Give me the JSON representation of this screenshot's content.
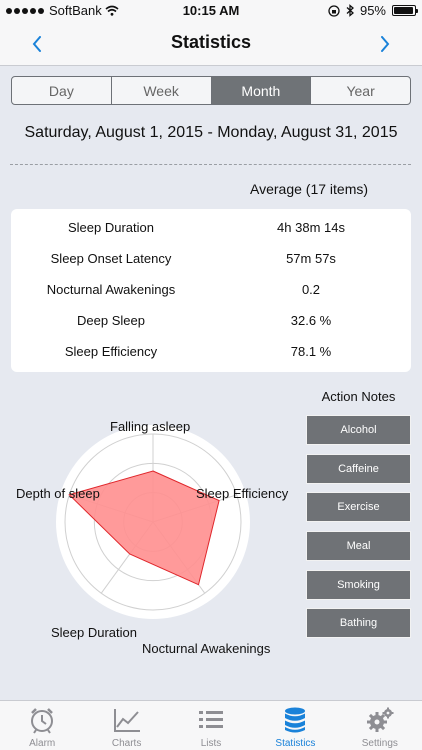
{
  "status_bar": {
    "carrier": "SoftBank",
    "time": "10:15 AM",
    "battery": "95%",
    "battery_level": 0.95
  },
  "nav": {
    "title": "Statistics"
  },
  "segments": [
    {
      "label": "Day",
      "active": false
    },
    {
      "label": "Week",
      "active": false
    },
    {
      "label": "Month",
      "active": true
    },
    {
      "label": "Year",
      "active": false
    }
  ],
  "date_range": "Saturday, August 1, 2015 - Monday, August 31, 2015",
  "average": {
    "title": "Average (17 items)",
    "rows": [
      {
        "label": "Sleep Duration",
        "value": "4h 38m 14s"
      },
      {
        "label": "Sleep Onset Latency",
        "value": "57m 57s"
      },
      {
        "label": "Nocturnal Awakenings",
        "value": "0.2"
      },
      {
        "label": "Deep Sleep",
        "value": "32.6 %"
      },
      {
        "label": "Sleep Efficiency",
        "value": "78.1 %"
      }
    ]
  },
  "radar": {
    "axes": [
      "Falling asleep",
      "Sleep Efficiency",
      "Nocturnal Awakenings",
      "Sleep Duration",
      "Depth of sleep"
    ],
    "values": [
      0.58,
      0.79,
      0.88,
      0.45,
      1.0
    ],
    "rings": 3,
    "fill_color": "#ff8f8f",
    "stroke_color": "#e0262b"
  },
  "action_notes": {
    "title": "Action Notes",
    "buttons": [
      "Alcohol",
      "Caffeine",
      "Exercise",
      "Meal",
      "Smoking",
      "Bathing"
    ]
  },
  "tabbar": [
    {
      "label": "Alarm",
      "icon": "alarm-clock-icon",
      "active": false
    },
    {
      "label": "Charts",
      "icon": "line-chart-icon",
      "active": false
    },
    {
      "label": "Lists",
      "icon": "list-icon",
      "active": false
    },
    {
      "label": "Statistics",
      "icon": "database-icon",
      "active": true
    },
    {
      "label": "Settings",
      "icon": "gear-icon",
      "active": false
    }
  ],
  "colors": {
    "accent": "#1a82d9",
    "segment_active": "#6f7377",
    "note_button": "#6f7276"
  }
}
